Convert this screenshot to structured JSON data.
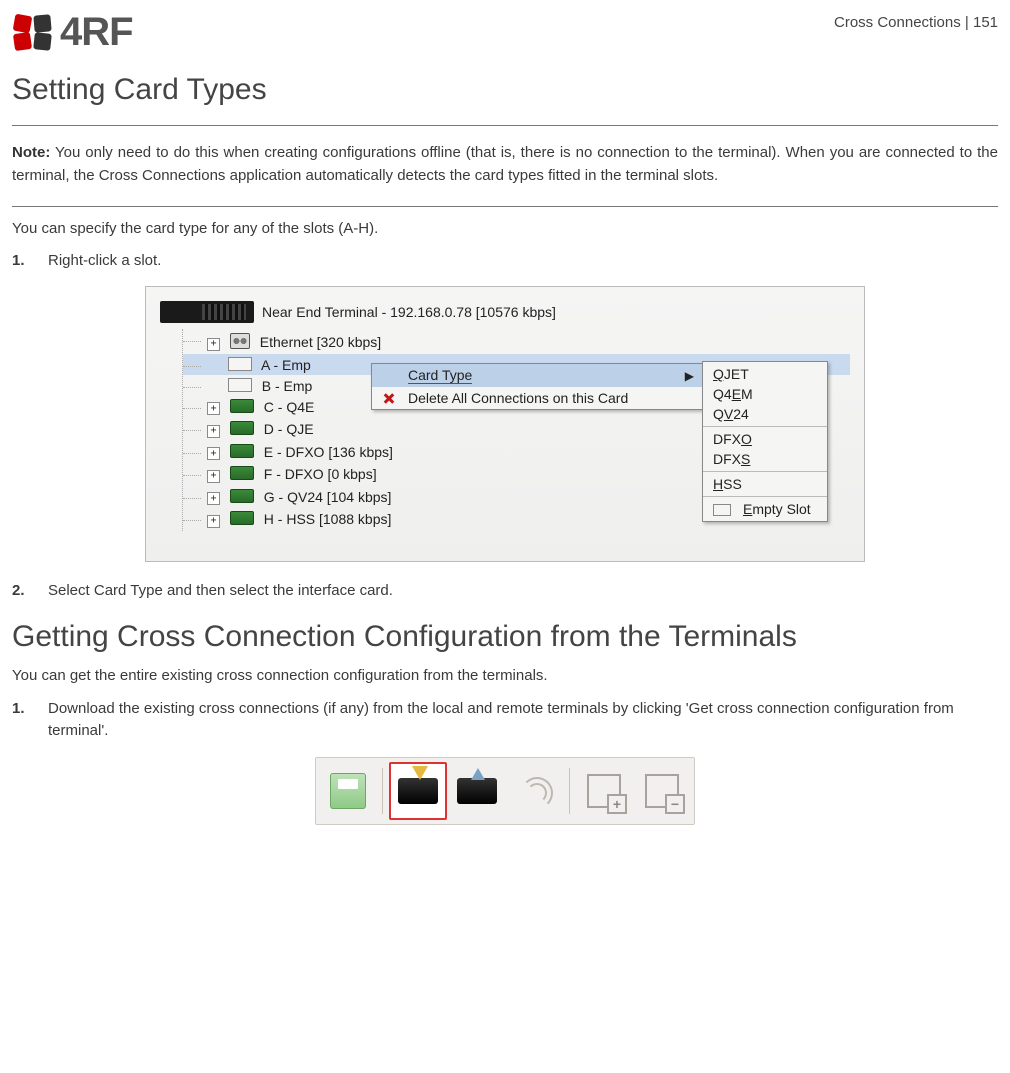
{
  "header": {
    "logo_text": "4RF",
    "running_head": "Cross Connections  |  151"
  },
  "section1": {
    "title": "Setting Card Types",
    "note_label": "Note:",
    "note_text": " You only need to do this when creating configurations offline (that is, there is no connection to the terminal). When you are connected to the terminal, the Cross Connections application automatically detects the card types fitted in the terminal slots.",
    "intro": "You can specify the card type for any of the slots (A-H).",
    "step1_num": "1.",
    "step1_text": "Right-click a slot.",
    "step2_num": "2.",
    "step2_text": "Select Card Type and then select the interface card."
  },
  "tree": {
    "root": "Near End Terminal - 192.168.0.78 [10576 kbps]",
    "ethernet": "Ethernet [320 kbps]",
    "slotA_prefix": "A - Emp",
    "slotB": "B - Emp",
    "slotC": "C - Q4E",
    "slotD": "D - QJE",
    "slotE": "E - DFXO [136 kbps]",
    "slotF": "F - DFXO [0 kbps]",
    "slotG": "G - QV24 [104 kbps]",
    "slotH": "H - HSS [1088 kbps]"
  },
  "ctx": {
    "card_type": "Card Type",
    "delete_all": "Delete All Connections on this Card"
  },
  "submenu": {
    "qjet": "QJET",
    "q4em": "Q4EM",
    "qv24": "QV24",
    "dfxo": "DFXO",
    "dfxs": "DFXS",
    "hss": "HSS",
    "empty": "Empty Slot"
  },
  "section2": {
    "title": "Getting Cross Connection Configuration from the Terminals",
    "intro": "You can get the entire existing cross connection configuration from the terminals.",
    "step1_num": "1.",
    "step1_text": "Download the existing cross connections (if any) from the local and remote terminals by clicking 'Get cross connection configuration from terminal'."
  }
}
